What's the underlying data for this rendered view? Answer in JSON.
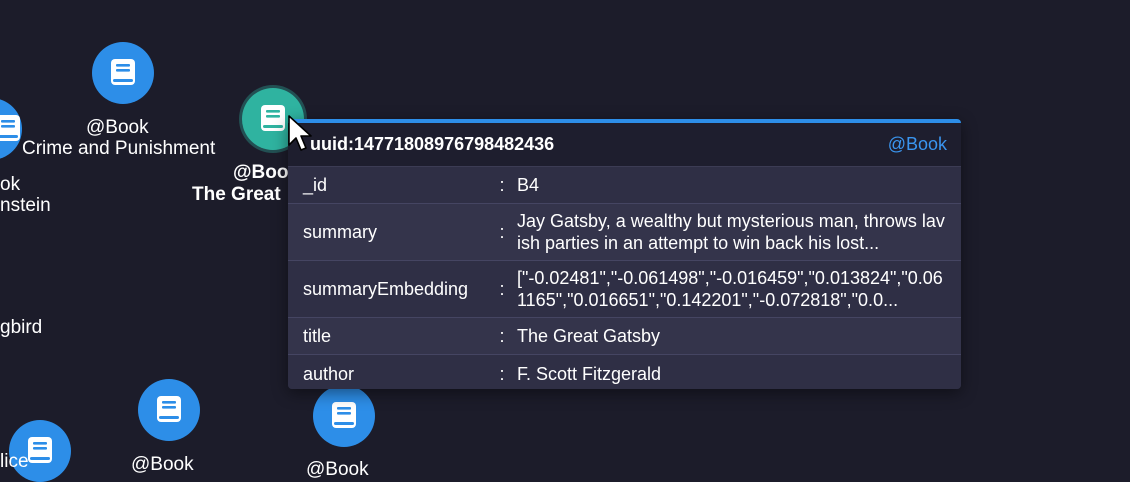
{
  "graph": {
    "nodes": [
      {
        "tag": "@Book",
        "title": "Crime and Punishment"
      },
      {
        "tag": "@Boo",
        "title": "The Great"
      },
      {
        "tag": "ok",
        "title": "nstein"
      },
      {
        "title": "gbird"
      },
      {
        "title": "lice"
      },
      {
        "tag": "@Book"
      },
      {
        "tag": "@Book"
      }
    ]
  },
  "tooltip": {
    "uuid": "uuid:14771808976798482436",
    "type_tag": "@Book",
    "rows": [
      {
        "key": "_id",
        "sep": ":",
        "value": "B4"
      },
      {
        "key": "summary",
        "sep": ":",
        "value": "Jay Gatsby, a wealthy but mysterious man, throws lavish parties in an attempt to win back his lost..."
      },
      {
        "key": "summaryEmbedding",
        "sep": ":",
        "value": "[\"-0.02481\",\"-0.061498\",\"-0.016459\",\"0.013824\",\"0.061165\",\"0.016651\",\"0.142201\",\"-0.072818\",\"0.0..."
      },
      {
        "key": "title",
        "sep": ":",
        "value": "The Great Gatsby"
      },
      {
        "key": "author",
        "sep": ":",
        "value": "F. Scott Fitzgerald"
      }
    ]
  },
  "colors": {
    "background": "#1c1c2a",
    "node": "#2d8ee8",
    "node_selected": "#2fb3a0",
    "accent": "#2d8ee8"
  },
  "icons": {
    "node_icon": "book-icon",
    "cursor": "mouse-pointer-icon"
  }
}
